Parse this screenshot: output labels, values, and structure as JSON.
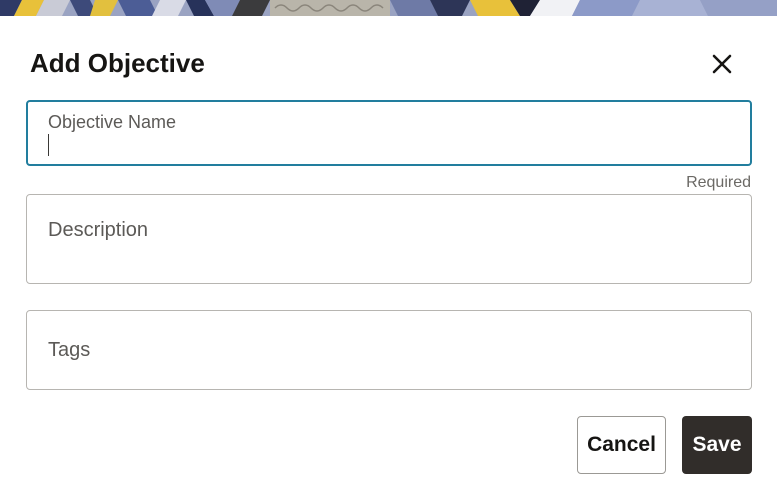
{
  "dialog": {
    "title": "Add Objective",
    "close_icon": "close-icon"
  },
  "fields": {
    "objective_name": {
      "label": "Objective Name",
      "value": "",
      "helper": "Required"
    },
    "description": {
      "label": "Description",
      "value": ""
    },
    "tags": {
      "label": "Tags",
      "value": ""
    }
  },
  "actions": {
    "cancel_label": "Cancel",
    "save_label": "Save"
  },
  "colors": {
    "focus_border": "#227e9e",
    "save_button_bg": "#312d2a",
    "text_primary": "#161513"
  }
}
